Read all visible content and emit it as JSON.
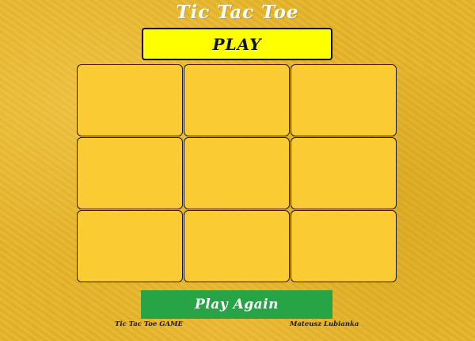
{
  "header": {
    "title": "Tic Tac Toe"
  },
  "status": {
    "label": "PLAY"
  },
  "board": {
    "cells": [
      "",
      "",
      "",
      "",
      "",
      "",
      "",
      "",
      ""
    ]
  },
  "actions": {
    "play_again_label": "Play Again"
  },
  "footer": {
    "left_text": "Tic Tac Toe GAME",
    "right_text": "Mateusz Lubianka"
  },
  "colors": {
    "background": "#e7b52a",
    "cell": "#fbcb34",
    "status_bg": "#ffff00",
    "play_again_bg": "#27a446",
    "title_text": "#ffffff"
  }
}
